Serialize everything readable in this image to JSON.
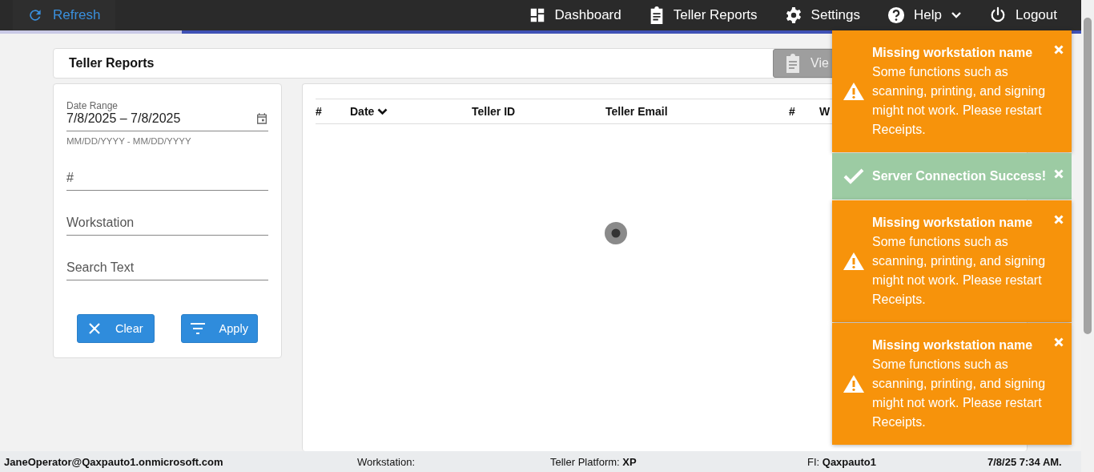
{
  "nav": {
    "refresh": "Refresh",
    "items": [
      {
        "label": "Dashboard",
        "dropdown": false
      },
      {
        "label": "Teller Reports",
        "dropdown": false
      },
      {
        "label": "Settings",
        "dropdown": false
      },
      {
        "label": "Help",
        "dropdown": true
      },
      {
        "label": "Logout",
        "dropdown": false
      }
    ]
  },
  "page_title": "Teller Reports",
  "view_button": "Vie",
  "filters": {
    "date_range": {
      "label": "Date Range",
      "value": "7/8/2025 – 7/8/2025",
      "hint": "MM/DD/YYYY - MM/DD/YYYY"
    },
    "fields": [
      {
        "placeholder": "#"
      },
      {
        "placeholder": "Workstation"
      },
      {
        "placeholder": "Search Text"
      }
    ],
    "buttons": [
      {
        "label": "Clear"
      },
      {
        "label": "Apply"
      }
    ]
  },
  "table": {
    "columns": [
      {
        "label": "#",
        "sorted": false
      },
      {
        "label": "Date",
        "sorted": true
      },
      {
        "label": "Teller ID",
        "sorted": false
      },
      {
        "label": "Teller Email",
        "sorted": false
      },
      {
        "label": "#",
        "sorted": false
      },
      {
        "label": "W"
      }
    ]
  },
  "toasts": [
    {
      "kind": "warning",
      "title": "Missing workstation name",
      "message": "Some functions such as scanning, printing, and signing might not work. Please restart Receipts."
    },
    {
      "kind": "success",
      "title": "Server Connection Success!"
    },
    {
      "kind": "warning",
      "title": "Missing workstation name",
      "message": "Some functions such as scanning, printing, and signing might not work. Please restart Receipts."
    },
    {
      "kind": "warning",
      "title": "Missing workstation name",
      "message": "Some functions such as scanning, printing, and signing might not work. Please restart Receipts."
    }
  ],
  "status_bar": [
    "**JaneOperator@Qaxpauto1.onmicrosoft.com**",
    "Workstation:",
    "Teller Platform: **XP**",
    "FI: **Qaxpauto1**",
    "**7/8/25 7:34 AM.**"
  ]
}
